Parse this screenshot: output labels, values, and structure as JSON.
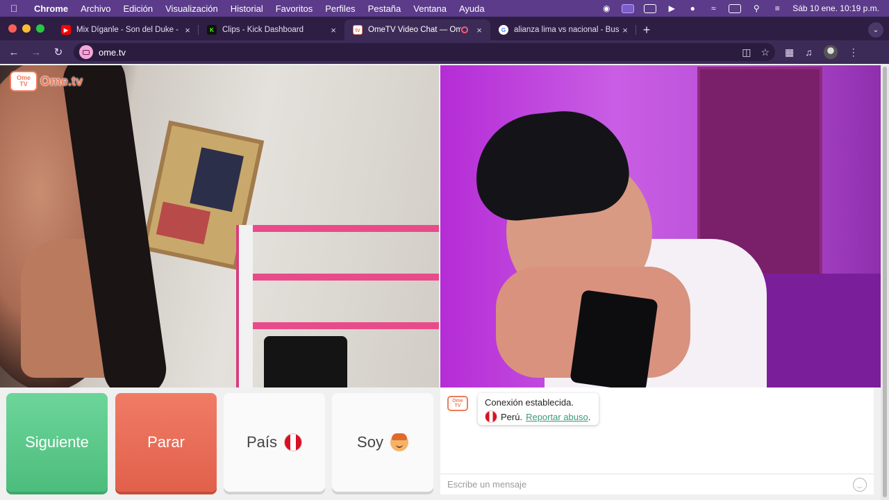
{
  "menubar": {
    "app_name": "Chrome",
    "items": [
      "Archivo",
      "Edición",
      "Visualización",
      "Historial",
      "Favoritos",
      "Perfiles",
      "Pestaña",
      "Ventana",
      "Ayuda"
    ],
    "clock": "Sáb 10 ene.  10:19 p.m."
  },
  "tabs": [
    {
      "title": "Mix Díganle - Son del Duke -",
      "favicon_color": "#ff0000"
    },
    {
      "title": "Clips - Kick Dashboard",
      "favicon_color": "#53fc18"
    },
    {
      "title": "OmeTV Video Chat — Ome",
      "favicon_color": "#f07a5a"
    },
    {
      "title": "alianza lima vs nacional - Bus",
      "favicon_color": "#4285f4"
    }
  ],
  "address_bar": {
    "url": "ome.tv"
  },
  "site": {
    "logo_top": "Ome",
    "logo_bottom": "TV",
    "logo_word": "Ome.tv"
  },
  "controls": {
    "next_label": "Siguiente",
    "stop_label": "Parar",
    "country_label": "País",
    "gender_label": "Soy"
  },
  "chat": {
    "status": "Conexión establecida.",
    "country": "Perú.",
    "report_link": "Reportar abuso",
    "report_suffix": ".",
    "input_placeholder": "Escribe un mensaje"
  },
  "colors": {
    "next_button": "#4cbd7c",
    "stop_button": "#e1604b",
    "brand": "#f07a5a"
  }
}
